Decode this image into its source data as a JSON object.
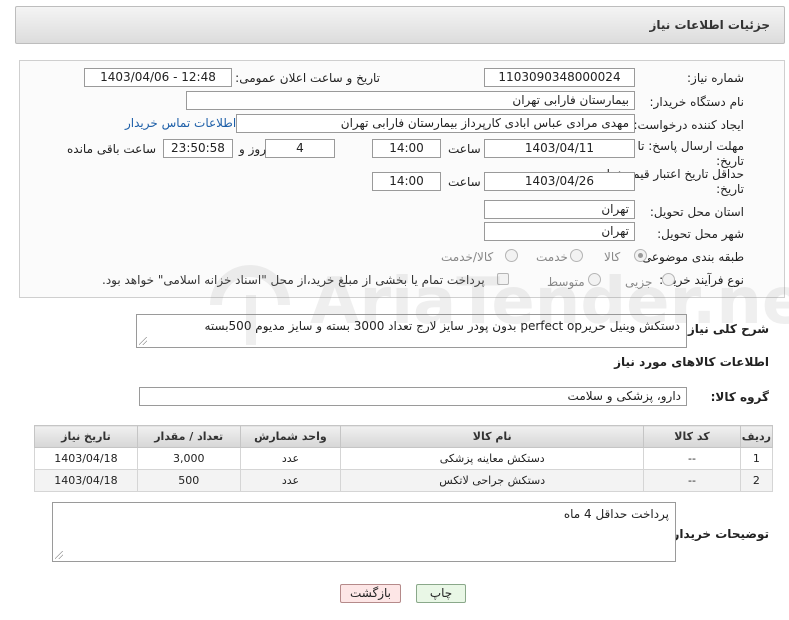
{
  "header": {
    "title": "جزئیات اطلاعات نیاز"
  },
  "form": {
    "need_number": {
      "label": "شماره نیاز:",
      "value": "1103090348000024"
    },
    "announce": {
      "label": "تاریخ و ساعت اعلان عمومی:",
      "value": "1403/04/06 - 12:48"
    },
    "buyer_org": {
      "label": "نام دستگاه خریدار:",
      "value": "بیمارستان فارابی تهران"
    },
    "creator": {
      "label": "ایجاد کننده درخواست:",
      "value": "مهدی مرادی عباس ابادی کارپرداز بیمارستان فارابی تهران",
      "contact_link": "اطلاعات تماس خریدار"
    },
    "reply_deadline": {
      "label_line1": "مهلت ارسال پاسخ: تا",
      "label_line2": "تاریخ:",
      "date": "1403/04/11",
      "time_label": "ساعت",
      "time": "14:00",
      "days": "4",
      "days_label": "روز و",
      "remaining": "23:50:58",
      "remaining_label": "ساعت باقی مانده"
    },
    "price_validity": {
      "label_line1": "حداقل تاریخ اعتبار قیمت: تا",
      "label_line2": "تاریخ:",
      "date": "1403/04/26",
      "time_label": "ساعت",
      "time": "14:00"
    },
    "province": {
      "label": "استان محل تحویل:",
      "value": "تهران"
    },
    "city": {
      "label": "شهر محل تحویل:",
      "value": "تهران"
    },
    "category": {
      "label": "طبقه بندی موضوعی:",
      "options": [
        "کالا",
        "خدمت",
        "کالا/خدمت"
      ],
      "selected": "کالا"
    },
    "process": {
      "label": "نوع فرآیند خرید :",
      "options": [
        "جزیی",
        "متوسط"
      ],
      "checkbox_text": "پرداخت تمام یا بخشی از مبلغ خرید،از محل \"اسناد خزانه اسلامی\" خواهد بود."
    }
  },
  "description": {
    "label": "شرح کلی نیاز:",
    "value": "دستکش وینیل حریرperfect op بدون پودر سایز لارج تعداد 3000 بسته و سایز مدیوم 500بسته"
  },
  "goods_section": {
    "title": "اطلاعات کالاهای مورد نیاز"
  },
  "goods_group": {
    "label": "گروه کالا:",
    "value": "دارو، پزشکی و سلامت"
  },
  "table": {
    "headers": [
      "ردیف",
      "کد کالا",
      "نام کالا",
      "واحد شمارش",
      "تعداد / مقدار",
      "تاریخ نیاز"
    ],
    "rows": [
      [
        "1",
        "--",
        "دستکش معاینه پزشکی",
        "عدد",
        "3,000",
        "1403/04/18"
      ],
      [
        "2",
        "--",
        "دستکش جراحی لاتکس",
        "عدد",
        "500",
        "1403/04/18"
      ]
    ]
  },
  "buyer_notes": {
    "label": "توضیحات خریدار:",
    "value": "پرداخت حداقل 4 ماه"
  },
  "buttons": {
    "print": "چاپ",
    "back": "بازگشت"
  },
  "watermark": {
    "text": "AriaTender.net"
  }
}
